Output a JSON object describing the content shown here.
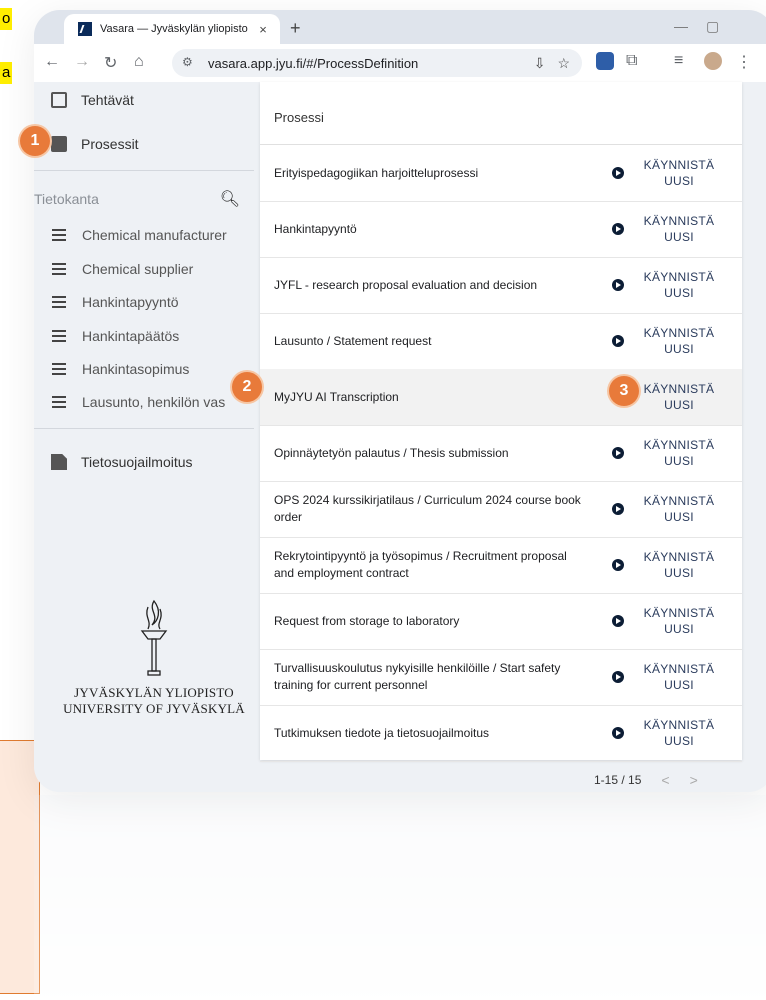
{
  "edge_snippets": [
    "o",
    "a"
  ],
  "browser": {
    "tab_title": "Vasara — Jyväskylän yliopisto",
    "tab_close": "×",
    "new_tab": "+",
    "url": "vasara.app.jyu.fi/#/ProcessDefinition"
  },
  "sidebar": {
    "nav": [
      {
        "label": "Tehtävät",
        "icon": "inbox-icon"
      },
      {
        "label": "Prosessit",
        "icon": "briefcase-icon"
      }
    ],
    "section_title": "Tietokanta",
    "db_items": [
      "Chemical manufacturer",
      "Chemical supplier",
      "Hankintapyyntö",
      "Hankintapäätös",
      "Hankintasopimus",
      "Lausunto, henkilön vas"
    ],
    "privacy": "Tietosuojailmoitus",
    "logo_line1": "JYVÄSKYLÄN YLIOPISTO",
    "logo_line2": "UNIVERSITY OF JYVÄSKYLÄ"
  },
  "list": {
    "header": "Prosessi",
    "start_line1": "KÄYNNISTÄ",
    "start_line2": "UUSI",
    "rows": [
      "Erityispedagogiikan harjoitteluprosessi",
      "Hankintapyyntö",
      "JYFL - research proposal evaluation and decision",
      "Lausunto / Statement request",
      "MyJYU AI Transcription",
      "Opinnäytetyön palautus / Thesis submission",
      "OPS 2024 kurssikirjatilaus / Curriculum 2024 course book order",
      "Rekrytointipyyntö ja työsopimus / Recruitment proposal and employment contract",
      "Request from storage to laboratory",
      "Turvallisuuskoulutus nykyisille henkilöille / Start safety training for current personnel",
      "Tutkimuksen tiedote ja tietosuojailmoitus"
    ],
    "pagination": "1-15 / 15"
  },
  "badges": [
    "1",
    "2",
    "3"
  ],
  "colors": {
    "badge": "#e87a3a",
    "highlight": "#ffee00",
    "play": "#0c1d35"
  }
}
